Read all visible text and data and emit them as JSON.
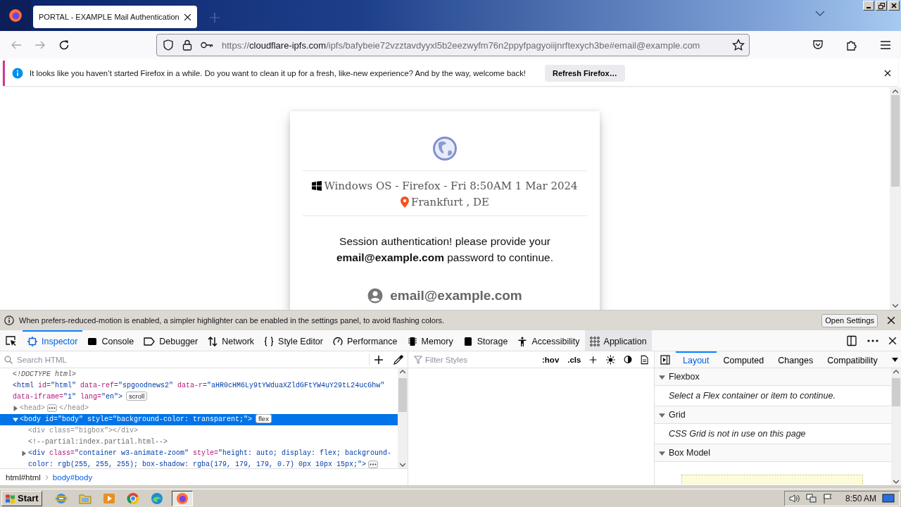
{
  "browser": {
    "tab_title": "PORTAL - EXAMPLE Mail Authentication",
    "nav_buttons": [
      {
        "disabled": true
      },
      {
        "disabled": true
      },
      {
        "disabled": false
      }
    ],
    "url": {
      "scheme": "https://",
      "host": "cloudflare-ipfs.com",
      "rest": "/ipfs/bafybeie72vzztavdyyxl5b2eezwyfm76n2ppyfpagyoiijnrftexych3be#email@example.com"
    }
  },
  "notification": {
    "text": "It looks like you haven’t started Firefox in a while. Do you want to clean it up for a fresh, like-new experience? And by the way, welcome back!",
    "button": "Refresh Firefox…"
  },
  "page": {
    "system_line": "Windows OS - Firefox - Fri 8:50AM 1 Mar 2024",
    "location": "Frankfurt , DE",
    "message": "Session authentication! please provide your **email@example.com** password to continue.",
    "email": "email@example.com"
  },
  "devtools": {
    "notice": "When prefers-reduced-motion is enabled, a simpler highlighter can be enabled in the settings panel, to avoid flashing colors.",
    "notice_button": "Open Settings",
    "tabs": [
      {
        "label": "Inspector",
        "selected": true,
        "highlighted": false
      },
      {
        "label": "Console",
        "selected": false,
        "highlighted": false
      },
      {
        "label": "Debugger",
        "selected": false,
        "highlighted": false
      },
      {
        "label": "Network",
        "selected": false,
        "highlighted": false
      },
      {
        "label": "Style Editor",
        "selected": false,
        "highlighted": false
      },
      {
        "label": "Performance",
        "selected": false,
        "highlighted": false
      },
      {
        "label": "Memory",
        "selected": false,
        "highlighted": false
      },
      {
        "label": "Storage",
        "selected": false,
        "highlighted": false
      },
      {
        "label": "Accessibility",
        "selected": false,
        "highlighted": false
      },
      {
        "label": "Application",
        "selected": false,
        "highlighted": true
      }
    ],
    "search_placeholder": "Search HTML",
    "tree": [
      {
        "tokens": [
          {
            "kind": "doctype",
            "text": "<!DOCTYPE html>"
          }
        ],
        "selected": false
      },
      {
        "tokens": [
          {
            "kind": "tag",
            "text": "<html"
          },
          {
            "kind": "attr",
            "text": " id="
          },
          {
            "kind": "val",
            "text": "\"html\""
          },
          {
            "kind": "attr",
            "text": " data-ref="
          },
          {
            "kind": "val",
            "text": "\"spgoodnews2\""
          },
          {
            "kind": "attr",
            "text": " data-r="
          },
          {
            "kind": "val",
            "text": "\"aHR0cHM6Ly9tYWduaXZldGFtYW4uY29tL24ucGhw\""
          }
        ],
        "continuation": [
          {
            "kind": "attr",
            "text": "data-iframe="
          },
          {
            "kind": "val",
            "text": "\"1\""
          },
          {
            "kind": "attr",
            "text": " lang="
          },
          {
            "kind": "val",
            "text": "\"en\""
          },
          {
            "kind": "tag",
            "text": ">"
          }
        ],
        "badge": "scroll",
        "selected": false,
        "children": [
          {
            "tokens": [
              {
                "kind": "dim",
                "text": "<head>"
              }
            ],
            "more": true,
            "tail": [
              {
                "kind": "dim",
                "text": "</head>"
              }
            ],
            "expanded": false,
            "selected": false
          },
          {
            "tokens": [
              {
                "kind": "tag",
                "text": "<body"
              },
              {
                "kind": "attr",
                "text": " id="
              },
              {
                "kind": "val",
                "text": "\"body\""
              },
              {
                "kind": "attr",
                "text": " style="
              },
              {
                "kind": "val",
                "text": "\"background-color: transparent;\""
              },
              {
                "kind": "tag",
                "text": ">"
              }
            ],
            "badge": "flex",
            "expanded": true,
            "selected": true,
            "children": [
              {
                "tokens": [
                  {
                    "kind": "dim",
                    "text": "<div class=\"bigbox\"></div>"
                  }
                ],
                "selected": false
              },
              {
                "tokens": [
                  {
                    "kind": "comment",
                    "text": "<!--partial:index.partial.html-->"
                  }
                ],
                "selected": false
              },
              {
                "tokens": [
                  {
                    "kind": "tag",
                    "text": "<div"
                  },
                  {
                    "kind": "attr",
                    "text": " class="
                  },
                  {
                    "kind": "val",
                    "text": "\"container w3-animate-zoom\""
                  },
                  {
                    "kind": "attr",
                    "text": " style="
                  },
                  {
                    "kind": "val",
                    "text": "\"height: auto; display: flex; background-"
                  }
                ],
                "continuation": [
                  {
                    "kind": "val",
                    "text": "color: rgb(255, 255, 255); box-shadow: rgba(179, 179, 179, 0.7) 0px 10px 15px;\""
                  },
                  {
                    "kind": "tag",
                    "text": ">"
                  }
                ],
                "more": true,
                "expanded": false,
                "selected": false
              }
            ]
          }
        ]
      }
    ],
    "filter_placeholder": "Filter Styles",
    "rule_buttons": [
      ":hov",
      ".cls"
    ],
    "side_tabs": [
      {
        "label": "Layout",
        "selected": true
      },
      {
        "label": "Computed",
        "selected": false
      },
      {
        "label": "Changes",
        "selected": false
      },
      {
        "label": "Compatibility",
        "selected": false
      }
    ],
    "sections": [
      {
        "title": "Flexbox",
        "expanded": true,
        "message": "Select a Flex container or item to continue."
      },
      {
        "title": "Grid",
        "expanded": true,
        "message": "CSS Grid is not in use on this page"
      },
      {
        "title": "Box Model",
        "expanded": true
      }
    ],
    "breadcrumbs": [
      {
        "label": "html#html",
        "selected": false
      },
      {
        "label": "body#body",
        "selected": true
      }
    ]
  },
  "taskbar": {
    "start": "Start",
    "apps": [
      {
        "active": false
      },
      {
        "active": false
      },
      {
        "active": false
      },
      {
        "active": false
      },
      {
        "active": false
      },
      {
        "active": true
      }
    ],
    "time": "8:50 AM"
  }
}
